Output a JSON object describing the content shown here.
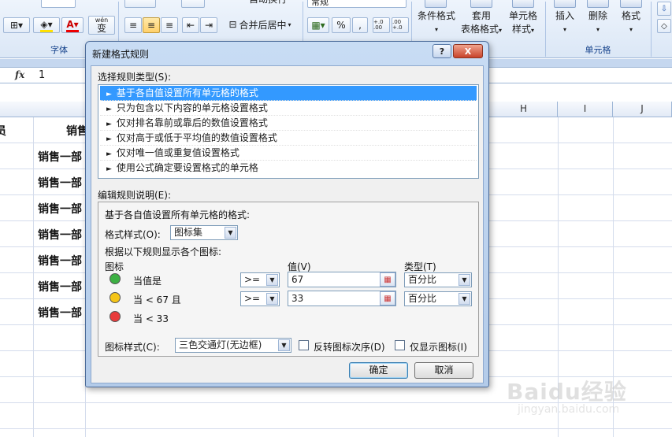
{
  "ribbon": {
    "groups": {
      "font": "字体",
      "cells": "单元格"
    },
    "number_format": "常规",
    "merge_center": "合并后居中",
    "wrap_text": "自动换行",
    "pct_symbol": "%",
    "comma_symbol": ",",
    "inc_decimal": "+.0 .00",
    "dec_decimal": ".00 +.0",
    "cond_format": {
      "line1": "条件格式",
      "line2": "▾"
    },
    "table_format": {
      "line1": "套用",
      "line2": "表格格式"
    },
    "cell_style": {
      "line1": "单元格",
      "line2": "样式"
    },
    "insert": "插入",
    "delete": "删除",
    "format": "格式",
    "pinyin_btn": "变",
    "wen_label": "wén"
  },
  "formula_bar": {
    "fx": "fx",
    "value": "1"
  },
  "sheet": {
    "columns": [
      "H",
      "I",
      "J"
    ],
    "partial_header_left": "员",
    "partial_header_mid": "销售",
    "rows": [
      "销售一部",
      "销售一部",
      "销售一部",
      "销售一部",
      "销售一部",
      "销售一部",
      "销售一部"
    ]
  },
  "dialog": {
    "title": "新建格式规则",
    "help": "?",
    "close": "X",
    "rule_type_label": "选择规则类型(S):",
    "rule_types": [
      "基于各自值设置所有单元格的格式",
      "只为包含以下内容的单元格设置格式",
      "仅对排名靠前或靠后的数值设置格式",
      "仅对高于或低于平均值的数值设置格式",
      "仅对唯一值或重复值设置格式",
      "使用公式确定要设置格式的单元格"
    ],
    "edit_label": "编辑规则说明(E):",
    "desc": "基于各自值设置所有单元格的格式:",
    "format_style_label": "格式样式(O):",
    "format_style_value": "图标集",
    "show_rule": "根据以下规则显示各个图标:",
    "col_icon": "图标",
    "col_value": "值(V)",
    "col_type": "类型(T)",
    "rules": [
      {
        "label": "当值是",
        "op": ">=",
        "value": "67",
        "type": "百分比",
        "color": "#3cb043"
      },
      {
        "label": "当 < 67 且",
        "op": ">=",
        "value": "33",
        "type": "百分比",
        "color": "#f5c518"
      },
      {
        "label": "当 < 33",
        "color": "#e83c3c"
      }
    ],
    "icon_style_label": "图标样式(C):",
    "icon_style_value": "三色交通灯(无边框)",
    "reverse_order": "反转图标次序(D)",
    "icon_only": "仅显示图标(I)",
    "ok": "确定",
    "cancel": "取消"
  },
  "watermark": {
    "brand": "Baidu经验",
    "url": "jingyan.baidu.com"
  }
}
